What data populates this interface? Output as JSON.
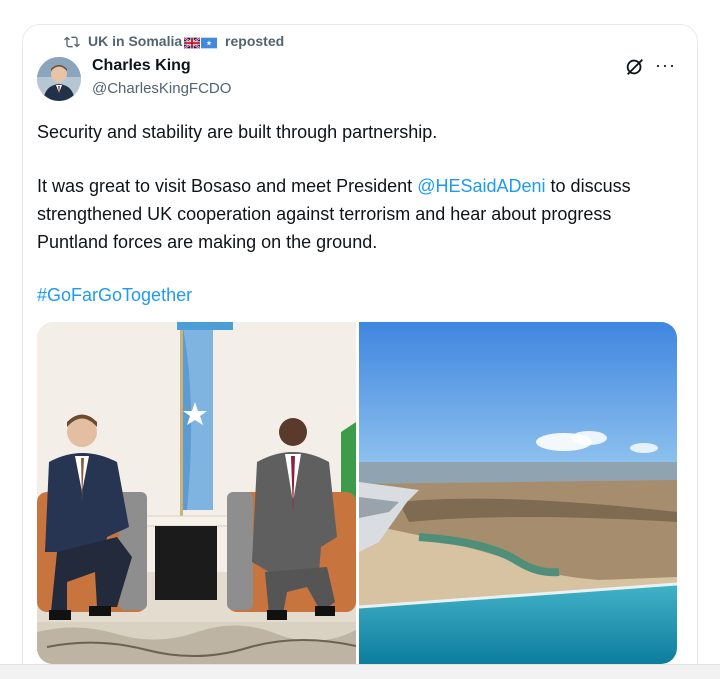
{
  "repost": {
    "account": "UK in Somalia",
    "label": "reposted",
    "flags": [
      "uk-flag-icon",
      "somalia-flag-icon"
    ]
  },
  "author": {
    "name": "Charles King",
    "handle": "@CharlesKingFCDO"
  },
  "tweet": {
    "line1": "Security and stability are built through partnership.",
    "para2_before": "It was great to visit Bosaso and meet President ",
    "mention": "@HESaidADeni",
    "para2_after": " to discuss strengthened UK cooperation against terrorism and hear about progress Puntland forces are making on the ground.",
    "hashtag": "#GoFarGoTogether"
  },
  "media": {
    "left": "meeting-photo",
    "right": "aerial-coast-photo"
  },
  "colors": {
    "link": "#1d9bf0",
    "secondary_text": "#536471",
    "primary_text": "#0f1419"
  }
}
